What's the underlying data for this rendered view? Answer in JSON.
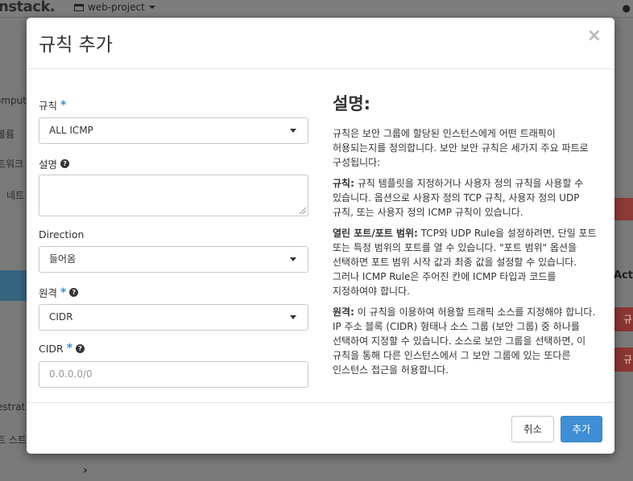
{
  "background": {
    "brand": "nstack.",
    "project": "web-project",
    "sidebar": [
      "omput",
      "볼륨",
      "트워크",
      "네트",
      "estrat",
      "트 스트"
    ],
    "right_actions_header": "Acti",
    "red_btn_label": "규"
  },
  "modal": {
    "title": "규칙 추가",
    "close": "×"
  },
  "form": {
    "rule": {
      "label": "규칙",
      "value": "ALL ICMP"
    },
    "description": {
      "label": "설명"
    },
    "direction": {
      "label": "Direction",
      "value": "들어옴"
    },
    "remote": {
      "label": "원격",
      "value": "CIDR"
    },
    "cidr": {
      "label": "CIDR",
      "placeholder": "0.0.0.0/0"
    }
  },
  "help": {
    "title": "설명:",
    "intro": "규칙은 보안 그룹에 할당된 인스턴스에게 어떤 트래픽이 허용되는지를 정의합니다. 보안 보안 규칙은 세가지 주요 파트로 구성됩니다:",
    "rule_term": "규칙:",
    "rule_text": " 규칙 템플릿을 지정하거나 사용자 정의 규칙을 사용할 수 있습니다. 옵션으로 사용자 정의 TCP 규칙, 사용자 정의 UDP 규칙, 또는 사용자 정의 ICMP 규칙이 있습니다.",
    "port_term": "열린 포트/포트 범위:",
    "port_text": " TCP와 UDP Rule을 설정하려면, 단일 포트 또는 특정 범위의 포트를 열 수 있습니다. \"포트 범위\" 옵션을 선택하면 포트 범위 시작 값과 최종 값을 설정할 수 있습니다. 그러나 ICMP Rule은 주어진 칸에 ICMP 타입과 코드를 지정하여야 합니다.",
    "remote_term": "원격:",
    "remote_text": " 이 규칙을 이용하여 허용할 트래픽 소스를 지정해야 합니다. IP 주소 블록 (CIDR) 형태나 소스 그룹 (보안 그룹) 중 하나를 선택하여 지정할 수 있습니다. 소스로 보안 그룹을 선택하면, 이 규칙을 통해 다른 인스턴스에서 그 보안 그룹에 있는 또다른 인스턴스 접근을 허용합니다."
  },
  "footer": {
    "cancel": "취소",
    "add": "추가"
  }
}
